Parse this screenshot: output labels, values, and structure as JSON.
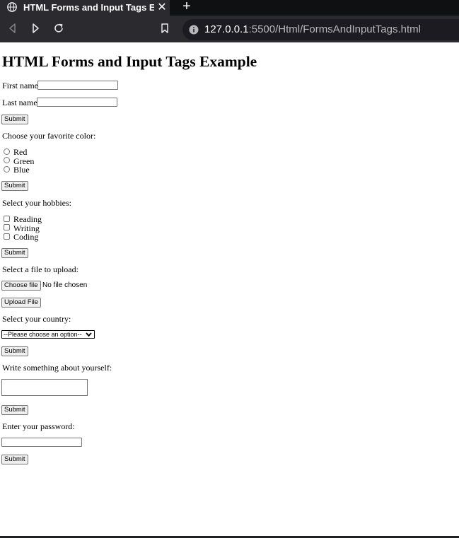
{
  "browser": {
    "tab_title": "HTML Forms and Input Tags Exam",
    "tab_close": "✕",
    "new_tab": "+",
    "url_host": "127.0.0.1",
    "url_rest": ":5500/Html/FormsAndInputTags.html"
  },
  "page": {
    "heading": "HTML Forms and Input Tags Example",
    "first_name_label": "First name:",
    "first_name_value": "",
    "last_name_label": "Last name:",
    "last_name_value": "",
    "submit_label": "Submit",
    "color_prompt": "Choose your favorite color:",
    "colors": [
      "Red",
      "Green",
      "Blue"
    ],
    "hobbies_prompt": "Select your hobbies:",
    "hobbies": [
      "Reading",
      "Writing",
      "Coding"
    ],
    "file_prompt": "Select a file to upload:",
    "choose_file_label": "Choose file",
    "no_file_text": "No file chosen",
    "upload_label": "Upload File",
    "country_prompt": "Select your country:",
    "country_selected": "--Please choose an option--",
    "about_prompt": "Write something about yourself:",
    "about_value": "",
    "password_prompt": "Enter your password:",
    "password_value": ""
  }
}
